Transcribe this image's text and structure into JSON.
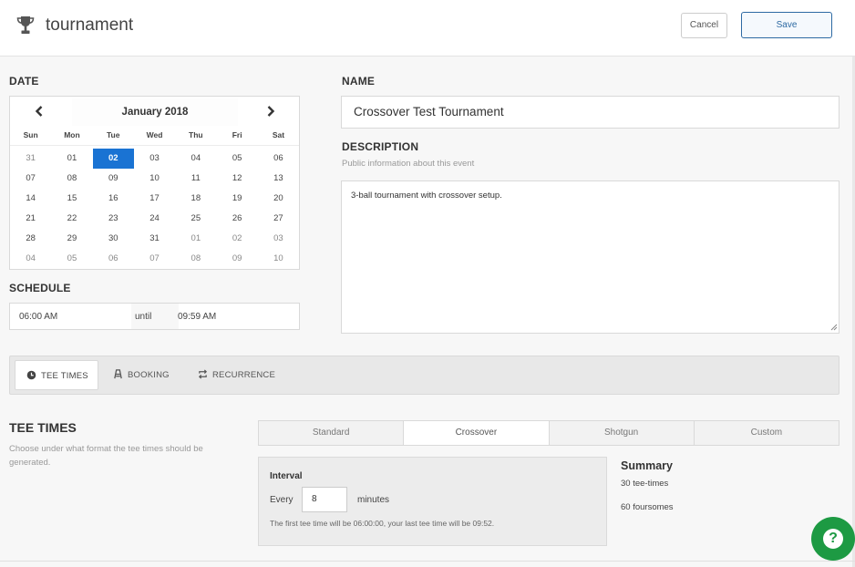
{
  "header": {
    "icon": "trophy-icon",
    "title": "tournament",
    "cancel_label": "Cancel",
    "save_label": "Save"
  },
  "date": {
    "label": "DATE",
    "month": "January 2018",
    "prev_icon": "chevron-left-icon",
    "next_icon": "chevron-right-icon",
    "dows": [
      "Sun",
      "Mon",
      "Tue",
      "Wed",
      "Thu",
      "Fri",
      "Sat"
    ],
    "weeks": [
      [
        "31",
        "01",
        "02",
        "03",
        "04",
        "05",
        "06"
      ],
      [
        "07",
        "08",
        "09",
        "10",
        "11",
        "12",
        "13"
      ],
      [
        "14",
        "15",
        "16",
        "17",
        "18",
        "19",
        "20"
      ],
      [
        "21",
        "22",
        "23",
        "24",
        "25",
        "26",
        "27"
      ],
      [
        "28",
        "29",
        "30",
        "31",
        "01",
        "02",
        "03"
      ],
      [
        "04",
        "05",
        "06",
        "07",
        "08",
        "09",
        "10"
      ]
    ],
    "selected": "02"
  },
  "schedule": {
    "label": "SCHEDULE",
    "from": "06:00 AM",
    "until_label": "until",
    "to": "09:59 AM"
  },
  "name": {
    "label": "NAME",
    "value": "Crossover Test Tournament"
  },
  "description": {
    "label": "DESCRIPTION",
    "hint": "Public information about this event",
    "value": "3-ball tournament with crossover setup."
  },
  "tabs": [
    {
      "label": "TEE TIMES",
      "icon": "clock-icon",
      "active": true
    },
    {
      "label": "BOOKING",
      "icon": "booking-icon",
      "active": false
    },
    {
      "label": "RECURRENCE",
      "icon": "recurrence-icon",
      "active": false
    }
  ],
  "tee_times": {
    "title": "TEE TIMES",
    "hint": "Choose under what format the tee times should be generated.",
    "formats": [
      "Standard",
      "Crossover",
      "Shotgun",
      "Custom"
    ],
    "selected_format": "Crossover",
    "interval_title": "Interval",
    "every_label": "Every",
    "interval_value": "8",
    "minutes_label": "minutes",
    "note": "The first tee time will be 06:00:00, your last tee time will be 09:52.",
    "summary_title": "Summary",
    "summary_tee_times": "30 tee-times",
    "summary_foursomes": "60 foursomes"
  },
  "help": {
    "icon": "help-icon",
    "glyph": "?"
  },
  "colors": {
    "accent": "#1a73d3",
    "save_border": "#2d6aa3",
    "help": "#1d9a43"
  }
}
